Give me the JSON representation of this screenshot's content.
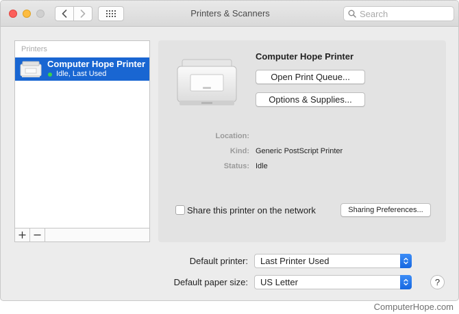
{
  "window": {
    "title": "Printers & Scanners",
    "search_placeholder": "Search"
  },
  "icons": {
    "back": "chevron-left-icon",
    "forward": "chevron-right-icon",
    "grid": "grid-icon",
    "search": "magnifier-icon",
    "add": "plus-icon",
    "remove": "minus-icon",
    "printer": "printer-icon"
  },
  "sidebar": {
    "header": "Printers",
    "printers": [
      {
        "name": "Computer Hope Printer",
        "status": "Idle, Last Used",
        "selected": true
      }
    ],
    "add_label": "+",
    "remove_label": "—"
  },
  "detail": {
    "printer_name": "Computer Hope Printer",
    "open_queue_label": "Open Print Queue...",
    "options_label": "Options & Supplies...",
    "info": {
      "location_label": "Location:",
      "location_value": "",
      "kind_label": "Kind:",
      "kind_value": "Generic PostScript Printer",
      "status_label": "Status:",
      "status_value": "Idle"
    },
    "share_label": "Share this printer on the network",
    "share_checked": false,
    "sharing_prefs_label": "Sharing Preferences..."
  },
  "defaults": {
    "default_printer_label": "Default printer:",
    "default_printer_value": "Last Printer Used",
    "paper_size_label": "Default paper size:",
    "paper_size_value": "US Letter"
  },
  "help_label": "?",
  "watermark": "ComputerHope.com",
  "colors": {
    "selection": "#1966d2",
    "status_dot": "#3bd44a",
    "popup_arrow": "#1667e0"
  }
}
